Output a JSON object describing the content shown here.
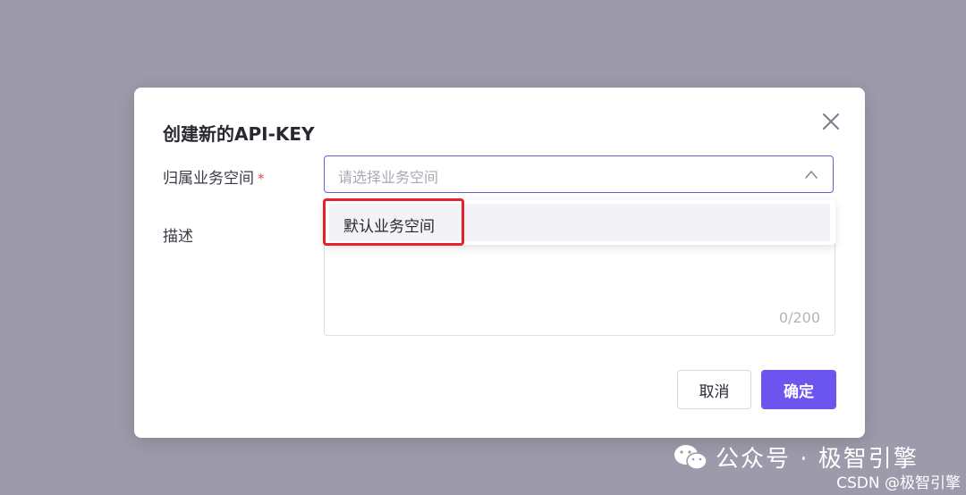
{
  "modal": {
    "title": "创建新的API-KEY",
    "fields": {
      "workspace": {
        "label": "归属业务空间",
        "required_mark": "*",
        "placeholder": "请选择业务空间",
        "dropdown_options": [
          "默认业务空间"
        ]
      },
      "description": {
        "label": "描述",
        "counter": "0/200"
      }
    },
    "buttons": {
      "cancel": "取消",
      "confirm": "确定"
    }
  },
  "colors": {
    "primary": "#6c55ee",
    "highlight": "#e0242a",
    "backdrop": "#9d9aab"
  },
  "watermark": {
    "official": "公众号 · 极智引擎",
    "csdn": "CSDN @极智引擎"
  }
}
